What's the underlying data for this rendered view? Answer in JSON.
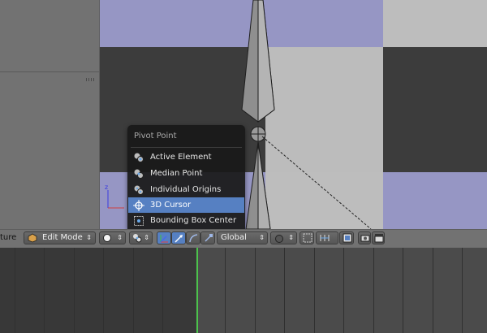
{
  "menu": {
    "title": "Pivot Point",
    "items": [
      {
        "label": "Active Element",
        "icon": "active-element-icon",
        "active": false
      },
      {
        "label": "Median Point",
        "icon": "median-point-icon",
        "active": false
      },
      {
        "label": "Individual Origins",
        "icon": "individual-origins-icon",
        "active": false
      },
      {
        "label": "3D Cursor",
        "icon": "3d-cursor-icon",
        "active": true
      },
      {
        "label": "Bounding Box Center",
        "icon": "bounding-box-icon",
        "active": false
      }
    ]
  },
  "toolbar": {
    "partial_label": "ture",
    "mode_label": "Edit Mode",
    "orientation_label": "Global"
  },
  "timeline": {
    "current_frame": 0
  },
  "colors": {
    "menu_highlight": "#5680c2",
    "playhead": "#4cc24c",
    "checker_blue": "#9898c6",
    "checker_dark": "#3e3e3e",
    "checker_light": "#bcbcbc"
  }
}
